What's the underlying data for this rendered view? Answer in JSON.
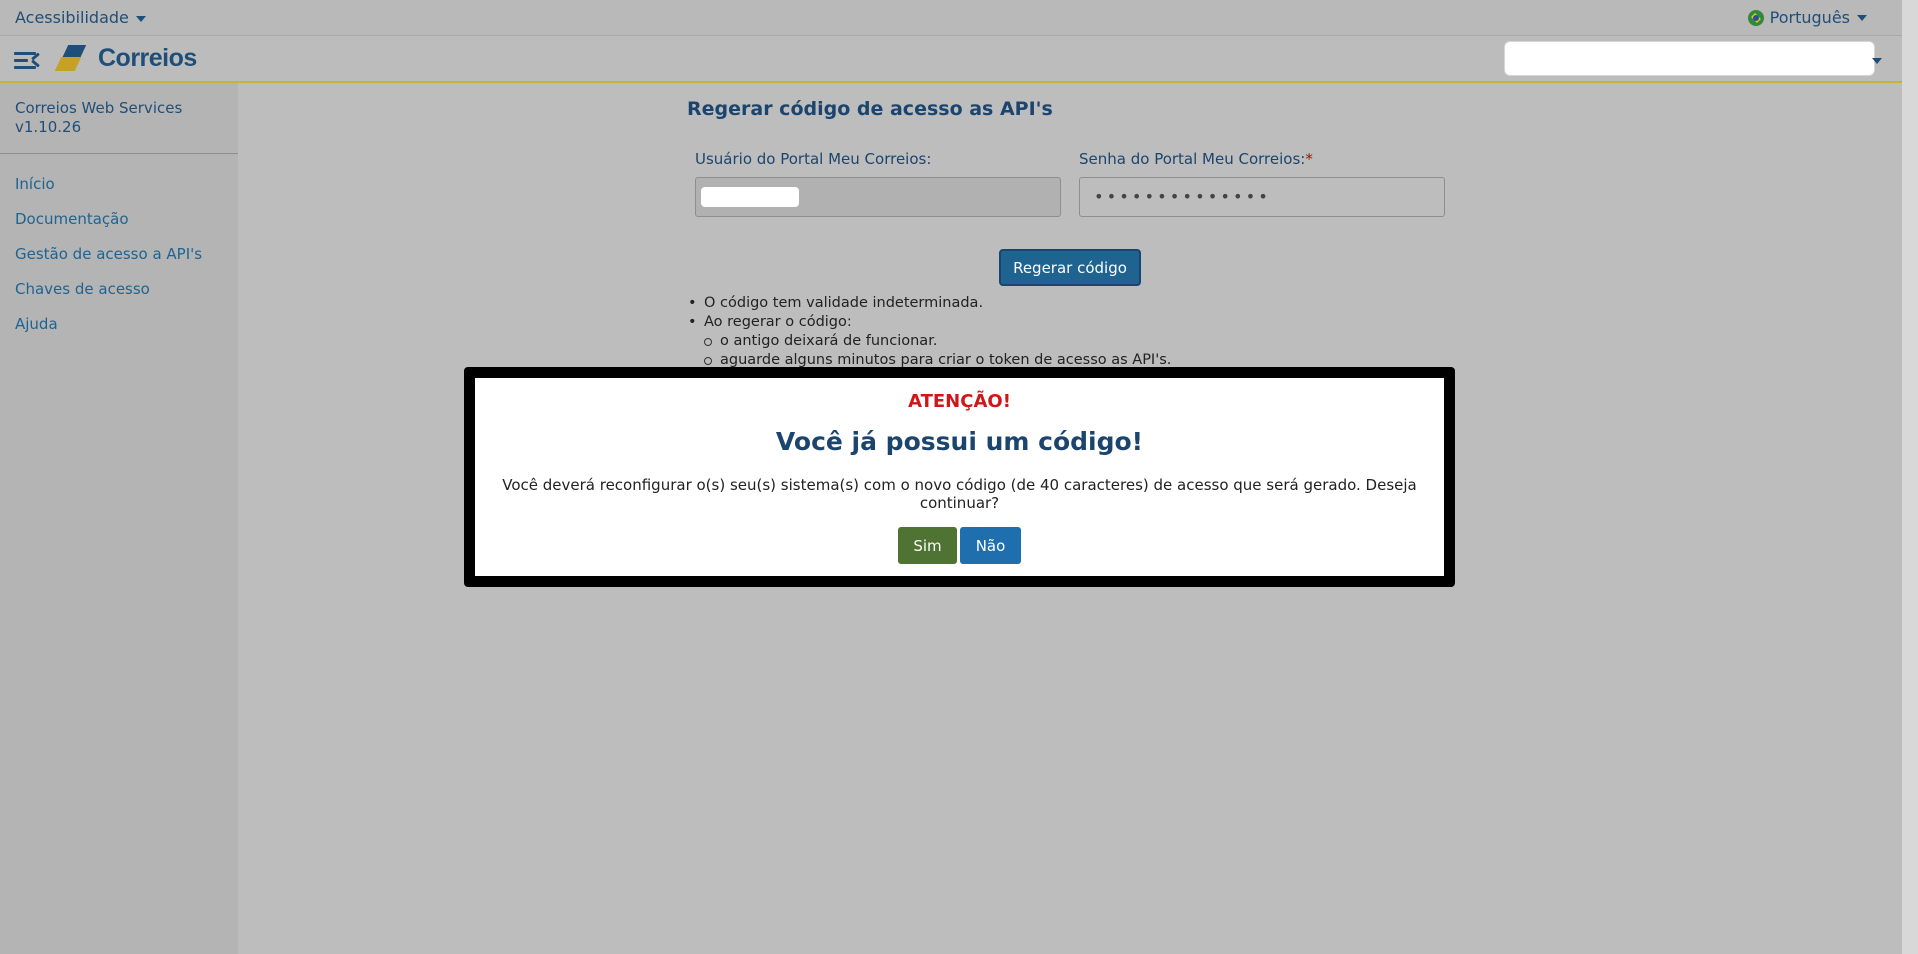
{
  "access_bar": {
    "accessibility_label": "Acessibilidade",
    "language_label": "Português"
  },
  "header": {
    "brand": "Correios",
    "search_value": ""
  },
  "sidebar": {
    "app_name": "Correios Web Services",
    "version": "v1.10.26",
    "items": [
      {
        "label": "Início"
      },
      {
        "label": "Documentação"
      },
      {
        "label": "Gestão de acesso a API's"
      },
      {
        "label": "Chaves de acesso"
      },
      {
        "label": "Ajuda"
      }
    ]
  },
  "main": {
    "title": "Regerar código de acesso as API's",
    "user_label": "Usuário do Portal Meu Correios:",
    "password_label": "Senha do Portal Meu Correios:",
    "required_mark": "*",
    "password_value": "••••••••••••••",
    "regen_button": "Regerar código",
    "notes": {
      "item1": "O código tem validade indeterminada.",
      "item2": "Ao regerar o código:",
      "sub1": "o antigo deixará de funcionar.",
      "sub2": "aguarde alguns minutos para criar o token de acesso as API's."
    }
  },
  "modal": {
    "warning": "ATENÇÃO!",
    "title": "Você já possui um código!",
    "message": "Você deverá reconfigurar o(s) seu(s) sistema(s) com o novo código (de 40 caracteres) de acesso que será gerado. Deseja continuar?",
    "yes_label": "Sim",
    "no_label": "Não"
  },
  "colors": {
    "primary": "#1f4e79",
    "gold": "#c6a222",
    "warning": "#d01616",
    "yes_button": "#4f7333",
    "no_button": "#1f6fae"
  }
}
